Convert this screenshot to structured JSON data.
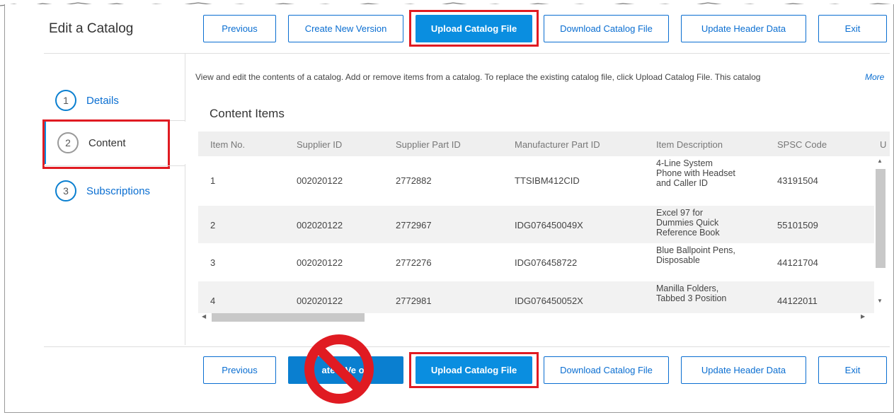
{
  "page_title": "Edit a Catalog",
  "toolbar": {
    "previous": "Previous",
    "create_new_version": "Create New Version",
    "upload_catalog_file": "Upload Catalog File",
    "download_catalog_file": "Download Catalog File",
    "update_header_data": "Update Header Data",
    "exit": "Exit"
  },
  "bottom_toolbar": {
    "previous": "Previous",
    "create_new_version_partial": "ate  v  Ve  on",
    "upload_catalog_file": "Upload Catalog File",
    "download_catalog_file": "Download Catalog File",
    "update_header_data": "Update Header Data",
    "exit": "Exit"
  },
  "steps": [
    {
      "num": "1",
      "label": "Details"
    },
    {
      "num": "2",
      "label": "Content"
    },
    {
      "num": "3",
      "label": "Subscriptions"
    }
  ],
  "description": "View and edit the contents of a catalog. Add or remove items from a catalog. To replace the existing catalog file, click Upload Catalog File. This catalog",
  "more_link": "More",
  "section_title": "Content Items",
  "table": {
    "headers": [
      "Item No.",
      "Supplier ID",
      "Supplier Part ID",
      "Manufacturer Part ID",
      "Item Description",
      "SPSC Code",
      "U"
    ],
    "rows": [
      {
        "item_no": "1",
        "supplier_id": "002020122",
        "supplier_part_id": "2772882",
        "manufacturer_part_id": "TTSIBM412CID",
        "description": "4-Line System Phone with Headset and Caller ID",
        "spsc": "43191504"
      },
      {
        "item_no": "2",
        "supplier_id": "002020122",
        "supplier_part_id": "2772967",
        "manufacturer_part_id": "IDG076450049X",
        "description": "Excel 97 for Dummies Quick Reference Book",
        "spsc": "55101509"
      },
      {
        "item_no": "3",
        "supplier_id": "002020122",
        "supplier_part_id": "2772276",
        "manufacturer_part_id": "IDG076458722",
        "description": "Blue Ballpoint Pens, Disposable",
        "spsc": "44121704"
      },
      {
        "item_no": "4",
        "supplier_id": "002020122",
        "supplier_part_id": "2772981",
        "manufacturer_part_id": "IDG076450052X",
        "description": "Manilla Folders, Tabbed 3 Position",
        "spsc": "44122011"
      }
    ]
  },
  "colors": {
    "accent": "#0a8ee0",
    "highlight": "#e01b22"
  }
}
